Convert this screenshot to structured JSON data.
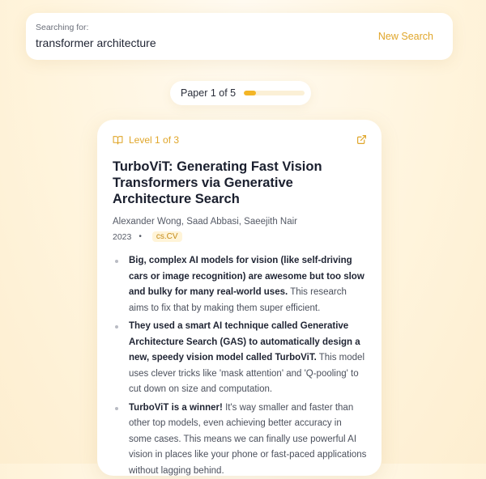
{
  "search": {
    "label": "Searching for:",
    "query": "transformer architecture",
    "new_search_label": "New Search"
  },
  "progress": {
    "text": "Paper 1 of 5",
    "fraction": 0.2
  },
  "paper": {
    "level": "Level 1 of 3",
    "title": "TurboViT: Generating Fast Vision Transformers via Generative Architecture Search",
    "authors": "Alexander Wong, Saad Abbasi, Saeejith Nair",
    "year": "2023",
    "category": "cs.CV",
    "summary": [
      {
        "bold": "Big, complex AI models for vision (like self-driving cars or image recognition) are awesome but too slow and bulky for many real-world uses.",
        "rest": " This research aims to fix that by making them super efficient."
      },
      {
        "bold": "They used a smart AI technique called Generative Architecture Search (GAS) to automatically design a new, speedy vision model called TurboViT.",
        "rest": " This model uses clever tricks like 'mask attention' and 'Q-pooling' to cut down on size and computation."
      },
      {
        "bold": "TurboViT is a winner!",
        "rest": " It's way smaller and faster than other top models, even achieving better accuracy in some cases. This means we can finally use powerful AI vision in places like your phone or fast-paced applications without lagging behind."
      }
    ]
  },
  "icons": {
    "book": "book-open-icon",
    "external": "external-link-icon"
  },
  "colors": {
    "accent": "#e0a62a",
    "progress_fill": "#f3b526",
    "progress_track": "#fbf0d6"
  }
}
